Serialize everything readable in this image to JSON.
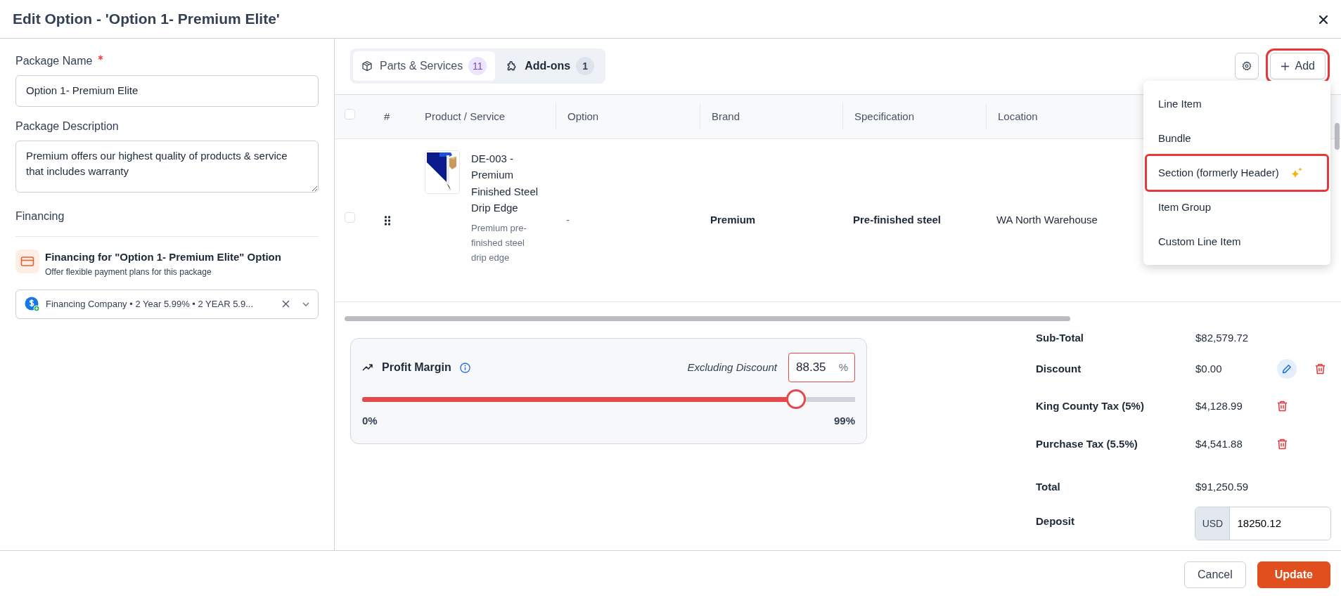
{
  "dialog": {
    "title": "Edit Option - 'Option 1- Premium Elite'"
  },
  "form": {
    "package_name_label": "Package Name",
    "required": true,
    "package_name": "Option 1- Premium Elite",
    "description_label": "Package Description",
    "description": "Premium offers our highest quality of products & service that includes warranty",
    "financing_heading": "Financing",
    "financing_title": "Financing for \"Option 1- Premium Elite\" Option",
    "financing_subtitle": "Offer flexible payment plans for this package",
    "financing_value": "Financing Company • 2 Year 5.99% • 2 YEAR 5.9..."
  },
  "tabs": [
    {
      "label": "Parts & Services",
      "count": "11",
      "selected": true
    },
    {
      "label": "Add-ons",
      "count": "1",
      "selected": false
    }
  ],
  "toolbar": {
    "add_label": "Add",
    "add_highlighted": true
  },
  "add_menu": [
    {
      "label": "Line Item",
      "highlighted": false,
      "new": false
    },
    {
      "label": "Bundle",
      "highlighted": false,
      "new": false
    },
    {
      "label": "Section (formerly Header)",
      "highlighted": true,
      "new": true
    },
    {
      "label": "Item Group",
      "highlighted": false,
      "new": false
    },
    {
      "label": "Custom Line Item",
      "highlighted": false,
      "new": false
    }
  ],
  "table": {
    "select_all_checked": false,
    "columns": [
      "#",
      "Product / Service",
      "Option",
      "Brand",
      "Specification",
      "Location"
    ],
    "rows": [
      {
        "checked": false,
        "name": "DE-003 - Premium Finished Steel Drip Edge",
        "description": "Premium pre-finished steel drip edge",
        "option": "-",
        "brand": "Premium",
        "specification": "Pre-finished steel",
        "location": "WA North Warehouse"
      }
    ]
  },
  "profit_margin": {
    "title": "Profit Margin",
    "mode_label": "Excluding Discount",
    "value": "88.35",
    "unit": "%",
    "level": 0.88,
    "min_label": "0%",
    "max_label": "99%"
  },
  "totals": [
    {
      "label": "Sub-Total",
      "value": "$82,579.72"
    },
    {
      "label": "Discount",
      "value": "$0.00",
      "editable": true,
      "deletable": true
    },
    {
      "label": "King County Tax (5%)",
      "value": "$4,128.99",
      "editable": false,
      "deletable": true
    },
    {
      "label": "Purchase Tax (5.5%)",
      "value": "$4,541.88",
      "editable": false,
      "deletable": true
    },
    {
      "label": "Total",
      "value": "$91,250.59"
    }
  ],
  "deposit": {
    "label": "Deposit",
    "currency": "USD",
    "value": "18250.12"
  },
  "footer_buttons": [
    {
      "label": "Cancel",
      "kind": "secondary"
    },
    {
      "label": "Update",
      "kind": "primary"
    }
  ]
}
